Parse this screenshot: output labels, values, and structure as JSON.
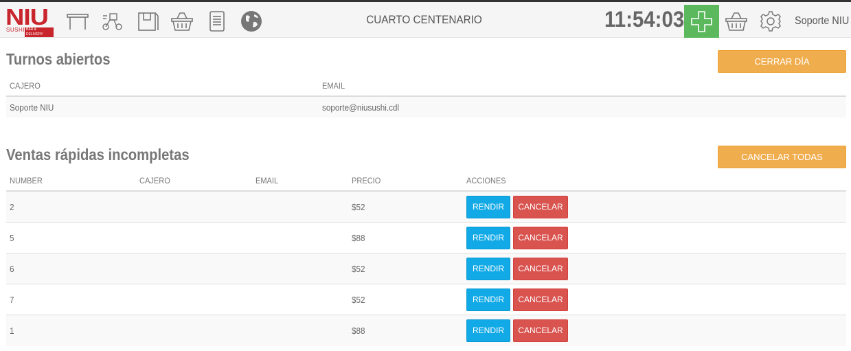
{
  "brand": {
    "name": "NIU",
    "sub": "SUSHI",
    "tag": "BAR & DELIVERY"
  },
  "header": {
    "branch": "CUARTO CENTENARIO",
    "clock": "11:54:03",
    "user": "Soporte NIU ▾",
    "icons": [
      "table-icon",
      "scooter-icon",
      "bag-icon",
      "basket-icon",
      "document-icon",
      "globe-icon",
      "add-icon",
      "cart-icon",
      "gear-icon"
    ]
  },
  "shifts": {
    "title": "Turnos abiertos",
    "close_day_label": "CERRAR DÍA",
    "columns": [
      "CAJERO",
      "EMAIL"
    ],
    "rows": [
      {
        "cajero": "Soporte NIU",
        "email": "soporte@niusushi.cdl"
      }
    ]
  },
  "sales": {
    "title": "Ventas rápidas incompletas",
    "cancel_all_label": "CANCELAR TODAS",
    "columns": [
      "NUMBER",
      "CAJERO",
      "EMAIL",
      "PRECIO",
      "ACCIONES"
    ],
    "render_label": "RENDIR",
    "cancel_label": "CANCELAR",
    "rows": [
      {
        "number": "2",
        "cajero": "",
        "email": "",
        "precio": "$52"
      },
      {
        "number": "5",
        "cajero": "",
        "email": "",
        "precio": "$88"
      },
      {
        "number": "6",
        "cajero": "",
        "email": "",
        "precio": "$52"
      },
      {
        "number": "7",
        "cajero": "",
        "email": "",
        "precio": "$52"
      },
      {
        "number": "1",
        "cajero": "",
        "email": "",
        "precio": "$88"
      }
    ]
  },
  "colors": {
    "accent_orange": "#f0ad4e",
    "success_green": "#5cb85c",
    "info_blue": "#11a9e6",
    "danger_red": "#d9534f",
    "brand_red": "#c9252c"
  }
}
